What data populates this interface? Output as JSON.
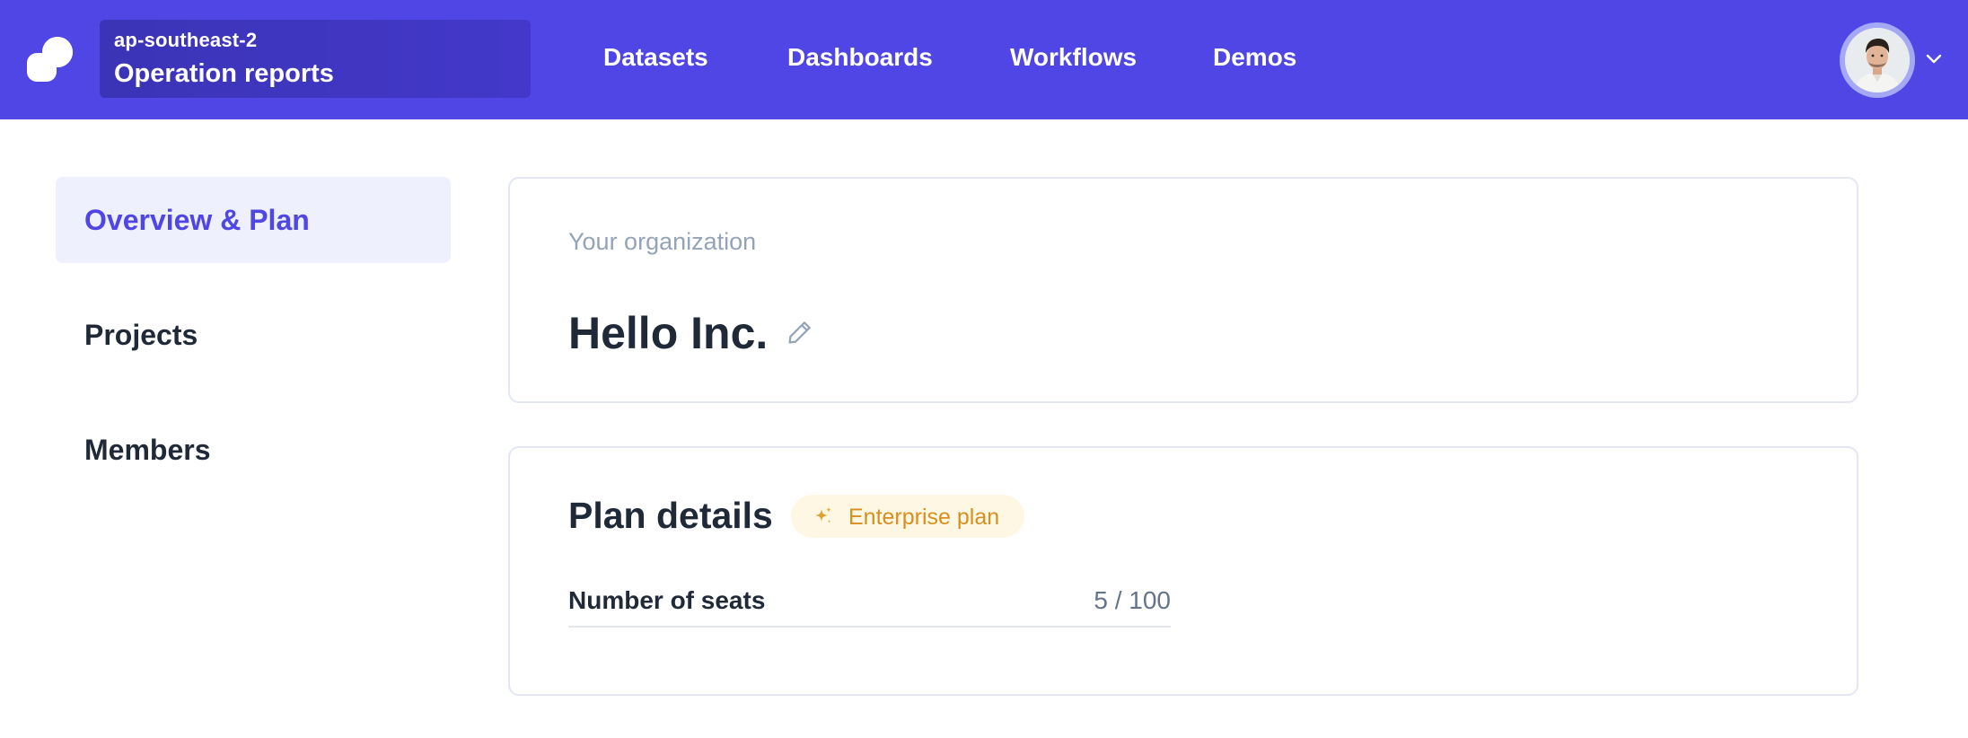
{
  "header": {
    "org_region": "ap-southeast-2",
    "org_name": "Operation reports",
    "nav": [
      {
        "label": "Datasets"
      },
      {
        "label": "Dashboards"
      },
      {
        "label": "Workflows"
      },
      {
        "label": "Demos"
      }
    ],
    "icons": {
      "logo": "app-logo",
      "avatar": "user-avatar",
      "menu": "chevron-down-icon"
    }
  },
  "sidebar": {
    "items": [
      {
        "label": "Overview & Plan",
        "active": true
      },
      {
        "label": "Projects",
        "active": false
      },
      {
        "label": "Members",
        "active": false
      }
    ]
  },
  "organization": {
    "caption": "Your organization",
    "name": "Hello Inc."
  },
  "plan": {
    "title": "Plan details",
    "badge": "Enterprise plan",
    "seats_label": "Number of seats",
    "seats_value": "5 / 100"
  },
  "colors": {
    "brand": "#4f46e5",
    "badge_text": "#d98e1d",
    "badge_bg": "#fef7e3"
  }
}
